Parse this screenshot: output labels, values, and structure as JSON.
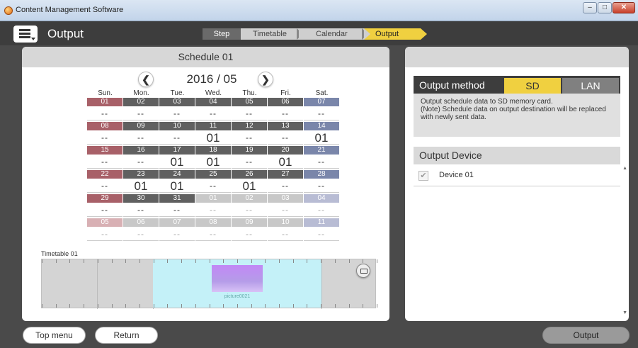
{
  "window": {
    "title": "Content Management Software"
  },
  "header": {
    "title": "Output",
    "steps": {
      "label": "Step",
      "items": [
        "Timetable",
        "Calendar",
        "Output"
      ],
      "active": "Output"
    }
  },
  "schedule": {
    "title": "Schedule 01",
    "month": "2016 / 05",
    "days_of_week": [
      "Sun.",
      "Mon.",
      "Tue.",
      "Wed.",
      "Thu.",
      "Fri.",
      "Sat."
    ],
    "weeks": [
      [
        {
          "d": "01",
          "v": "--"
        },
        {
          "d": "02",
          "v": "--"
        },
        {
          "d": "03",
          "v": "--"
        },
        {
          "d": "04",
          "v": "--"
        },
        {
          "d": "05",
          "v": "--"
        },
        {
          "d": "06",
          "v": "--"
        },
        {
          "d": "07",
          "v": "--"
        }
      ],
      [
        {
          "d": "08",
          "v": "--"
        },
        {
          "d": "09",
          "v": "--"
        },
        {
          "d": "10",
          "v": "--"
        },
        {
          "d": "11",
          "v": "01"
        },
        {
          "d": "12",
          "v": "--"
        },
        {
          "d": "13",
          "v": "--"
        },
        {
          "d": "14",
          "v": "01"
        }
      ],
      [
        {
          "d": "15",
          "v": "--"
        },
        {
          "d": "16",
          "v": "--"
        },
        {
          "d": "17",
          "v": "01"
        },
        {
          "d": "18",
          "v": "01"
        },
        {
          "d": "19",
          "v": "--"
        },
        {
          "d": "20",
          "v": "01"
        },
        {
          "d": "21",
          "v": "--"
        }
      ],
      [
        {
          "d": "22",
          "v": "--"
        },
        {
          "d": "23",
          "v": "01"
        },
        {
          "d": "24",
          "v": "01"
        },
        {
          "d": "25",
          "v": "--"
        },
        {
          "d": "26",
          "v": "01"
        },
        {
          "d": "27",
          "v": "--"
        },
        {
          "d": "28",
          "v": "--"
        }
      ],
      [
        {
          "d": "29",
          "v": "--"
        },
        {
          "d": "30",
          "v": "--"
        },
        {
          "d": "31",
          "v": "--"
        },
        {
          "d": "01",
          "v": "--",
          "out": true
        },
        {
          "d": "02",
          "v": "--",
          "out": true
        },
        {
          "d": "03",
          "v": "--",
          "out": true
        },
        {
          "d": "04",
          "v": "--",
          "out": true
        }
      ],
      [
        {
          "d": "05",
          "v": "--",
          "out": true
        },
        {
          "d": "06",
          "v": "--",
          "out": true
        },
        {
          "d": "07",
          "v": "--",
          "out": true
        },
        {
          "d": "08",
          "v": "--",
          "out": true
        },
        {
          "d": "09",
          "v": "--",
          "out": true
        },
        {
          "d": "10",
          "v": "--",
          "out": true
        },
        {
          "d": "11",
          "v": "--",
          "out": true
        }
      ]
    ],
    "timetable": {
      "label": "Timetable 01",
      "content_name": "picture0021"
    }
  },
  "output_method": {
    "title": "Output method",
    "options": {
      "sd": "SD",
      "lan": "LAN"
    },
    "selected": "SD",
    "description_1": "Output schedule data to SD memory card.",
    "description_2": "(Note) Schedule data on output destination will be replaced with newly sent data."
  },
  "output_device": {
    "title": "Output Device",
    "devices": [
      {
        "name": "Device 01",
        "checked": true
      }
    ]
  },
  "footer": {
    "top_menu": "Top menu",
    "return": "Return",
    "output": "Output"
  }
}
